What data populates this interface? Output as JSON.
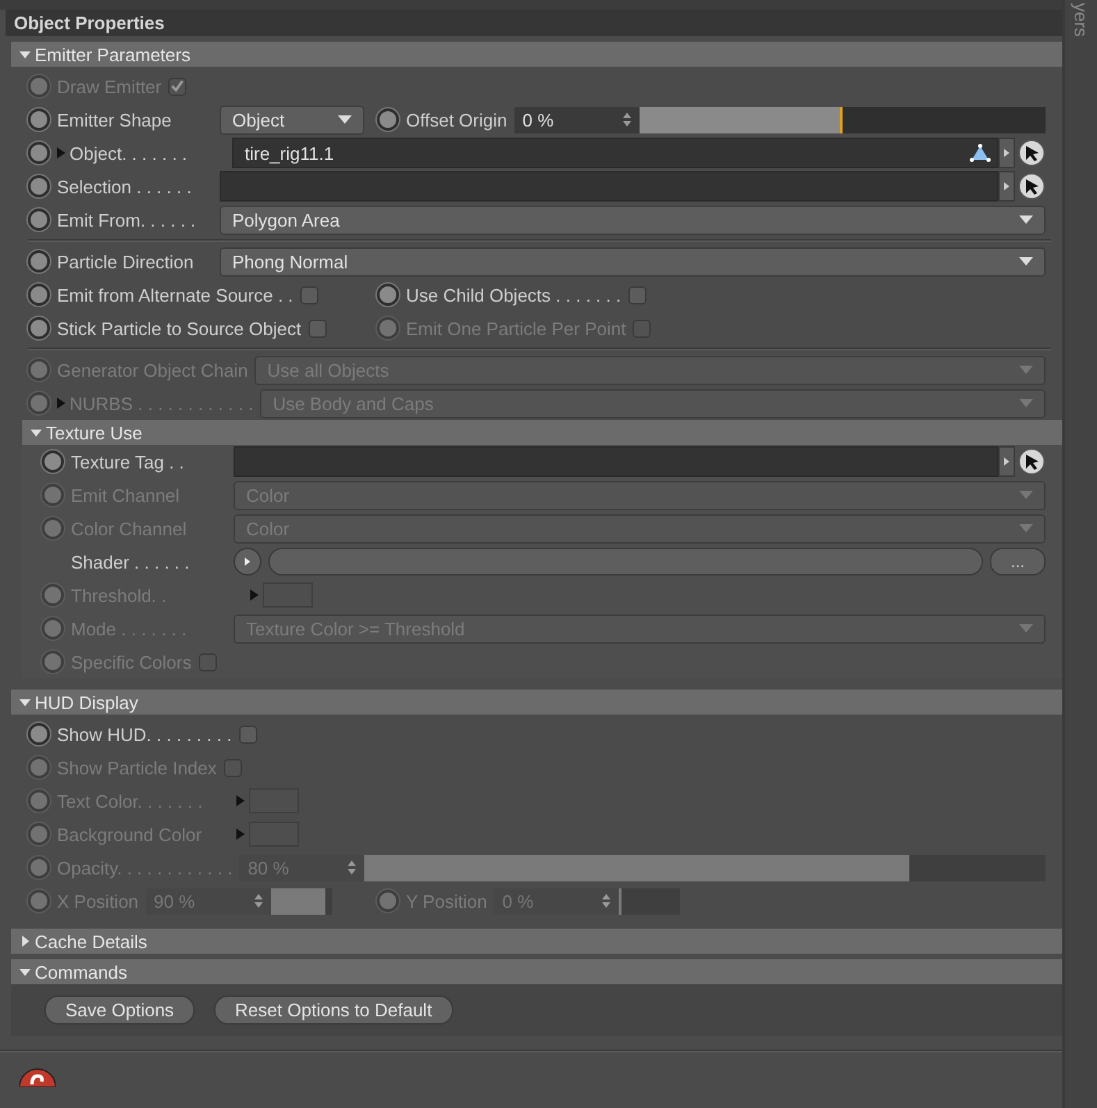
{
  "panel": {
    "title": "Object Properties"
  },
  "side_tab": {
    "label": "yers"
  },
  "sections": [
    {
      "title": "Emitter Parameters",
      "expanded": true,
      "rows": [
        {
          "kind": "params",
          "params": [
            {
              "kind": "checkbox",
              "label": "Draw Emitter",
              "animatable": true,
              "disabled": true,
              "checked": true
            }
          ]
        },
        {
          "kind": "params",
          "params": [
            {
              "kind": "dropdown",
              "label": "Emitter Shape",
              "animatable": true,
              "disabled": false,
              "value": "Object"
            },
            {
              "kind": "slider",
              "label": "Offset Origin",
              "animatable": true,
              "disabled": false,
              "value": "0 %",
              "level": 0.5
            }
          ]
        },
        {
          "kind": "params",
          "params": [
            {
              "kind": "link",
              "label": "Object. . . . . . .",
              "animatable": true,
              "disabled": false,
              "expander": true,
              "object_icon": true,
              "value": "tire_rig11.1"
            }
          ]
        },
        {
          "kind": "params",
          "params": [
            {
              "kind": "link",
              "label": "Selection . . . . . .",
              "animatable": true,
              "disabled": false,
              "object_icon": false
            }
          ]
        },
        {
          "kind": "params",
          "params": [
            {
              "kind": "dropdown",
              "label": "Emit From. . . . . .",
              "animatable": true,
              "disabled": false,
              "value": "Polygon Area"
            }
          ]
        },
        {
          "kind": "divider"
        },
        {
          "kind": "params",
          "params": [
            {
              "kind": "dropdown",
              "label": "Particle Direction",
              "animatable": true,
              "disabled": false,
              "value": "Phong Normal"
            }
          ]
        },
        {
          "kind": "params",
          "params": [
            {
              "kind": "checkbox",
              "label": "Emit from Alternate Source . .",
              "animatable": true,
              "disabled": false,
              "checked": false
            },
            {
              "kind": "checkbox",
              "label": "Use Child Objects . . . . . . .",
              "animatable": true,
              "disabled": false,
              "checked": false
            }
          ]
        },
        {
          "kind": "params",
          "params": [
            {
              "kind": "checkbox",
              "label": "Stick Particle to Source Object",
              "animatable": true,
              "disabled": false,
              "checked": false
            },
            {
              "kind": "checkbox",
              "label": "Emit One Particle Per Point",
              "animatable": true,
              "disabled": true,
              "checked": false
            }
          ]
        },
        {
          "kind": "divider"
        },
        {
          "kind": "params",
          "params": [
            {
              "kind": "dropdown",
              "label": "Generator Object Chain",
              "animatable": true,
              "disabled": true,
              "value": "Use all Objects"
            }
          ]
        },
        {
          "kind": "params",
          "params": [
            {
              "kind": "dropdown",
              "label": "NURBS . . . . . . . . . . . .",
              "animatable": true,
              "disabled": true,
              "expander": true,
              "value": "Use Body and Caps"
            }
          ]
        },
        {
          "kind": "group",
          "title": "Texture Use",
          "expanded": true,
          "rows": [
            {
              "kind": "params",
              "params": [
                {
                  "kind": "link",
                  "label": "Texture Tag . .",
                  "animatable": true,
                  "disabled": false,
                  "object_icon": false
                }
              ]
            },
            {
              "kind": "params",
              "params": [
                {
                  "kind": "dropdown",
                  "label": "Emit Channel",
                  "animatable": true,
                  "disabled": true,
                  "value": "Color"
                }
              ]
            },
            {
              "kind": "params",
              "params": [
                {
                  "kind": "dropdown",
                  "label": "Color Channel",
                  "animatable": true,
                  "disabled": true,
                  "value": "Color"
                }
              ]
            },
            {
              "kind": "params",
              "params": [
                {
                  "kind": "shader",
                  "label": "Shader . . . . . .",
                  "animatable": false,
                  "disabled": false,
                  "browse_label": "..."
                }
              ]
            },
            {
              "kind": "params",
              "params": [
                {
                  "kind": "color",
                  "label": "Threshold. .",
                  "animatable": true,
                  "disabled": true
                }
              ]
            },
            {
              "kind": "params",
              "params": [
                {
                  "kind": "dropdown",
                  "label": "Mode . . . . . . .",
                  "animatable": true,
                  "disabled": true,
                  "value": "Texture Color >= Threshold"
                }
              ]
            },
            {
              "kind": "params",
              "params": [
                {
                  "kind": "checkbox",
                  "label": "Specific Colors",
                  "animatable": true,
                  "disabled": true,
                  "checked": false
                }
              ]
            }
          ]
        }
      ]
    },
    {
      "title": "HUD Display",
      "expanded": true,
      "rows": [
        {
          "kind": "params",
          "params": [
            {
              "kind": "checkbox",
              "label": "Show HUD. . . . . . . . .",
              "animatable": true,
              "disabled": false,
              "checked": false
            }
          ]
        },
        {
          "kind": "params",
          "params": [
            {
              "kind": "checkbox",
              "label": "Show Particle Index",
              "animatable": true,
              "disabled": true,
              "checked": false
            }
          ]
        },
        {
          "kind": "params",
          "params": [
            {
              "kind": "color",
              "label": "Text Color. . . . . . .",
              "animatable": true,
              "disabled": true
            }
          ]
        },
        {
          "kind": "params",
          "params": [
            {
              "kind": "color",
              "label": "Background Color",
              "animatable": true,
              "disabled": true
            }
          ]
        },
        {
          "kind": "params",
          "params": [
            {
              "kind": "slider",
              "label": "Opacity. . . . . . . . . . . .",
              "animatable": true,
              "disabled": true,
              "value": "80 %",
              "level": 0.8
            }
          ]
        },
        {
          "kind": "params",
          "params": [
            {
              "kind": "slider_compact",
              "label": "X Position",
              "animatable": true,
              "disabled": true,
              "value": "90 %",
              "level": 0.9
            },
            {
              "kind": "slider_compact",
              "label": "Y Position",
              "animatable": true,
              "disabled": true,
              "value": "0 %",
              "level": 0
            }
          ]
        }
      ]
    },
    {
      "title": "Cache Details",
      "expanded": false
    },
    {
      "title": "Commands",
      "expanded": true,
      "buttons": [
        "Save Options",
        "Reset Options to Default"
      ]
    }
  ]
}
